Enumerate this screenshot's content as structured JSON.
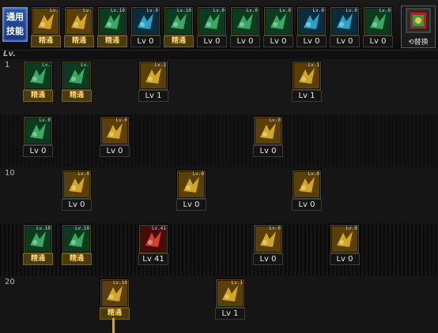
{
  "header": {
    "common_tab": [
      "通用",
      "技能"
    ],
    "lv_label": "Lv.",
    "swap_label": "⟲替换"
  },
  "colors": {
    "gold": "#e0b12c",
    "green": "#3fb56b",
    "blue": "#2fb0d8",
    "red": "#c62a2a"
  },
  "quickbar": [
    {
      "icon": "gold-fist-skill-icon",
      "tag": "Lv.",
      "caption": "精通",
      "kind": "mast",
      "color": "gold"
    },
    {
      "icon": "gold-claw-skill-icon",
      "tag": "Lv.",
      "caption": "精通",
      "kind": "mast",
      "color": "gold"
    },
    {
      "icon": "green-runner-skill-icon",
      "tag": "Lv.10",
      "caption": "精通",
      "kind": "mast",
      "color": "green"
    },
    {
      "icon": "blue-wings-skill-icon",
      "tag": "Lv.0",
      "caption": "Lv 0",
      "kind": "lv",
      "color": "blue"
    },
    {
      "icon": "green-target-skill-icon",
      "tag": "Lv.10",
      "caption": "精通",
      "kind": "mast",
      "color": "green"
    },
    {
      "icon": "green-target-skill-icon",
      "tag": "Lv.0",
      "caption": "Lv 0",
      "kind": "lv",
      "color": "green"
    },
    {
      "icon": "green-figure-skill-icon",
      "tag": "Lv.0",
      "caption": "Lv 0",
      "kind": "lv",
      "color": "green"
    },
    {
      "icon": "green-figure-skill-icon",
      "tag": "Lv.0",
      "caption": "Lv 0",
      "kind": "lv",
      "color": "green"
    },
    {
      "icon": "blue-ring-skill-icon",
      "tag": "Lv.0",
      "caption": "Lv 0",
      "kind": "lv",
      "color": "blue"
    },
    {
      "icon": "blue-robot-skill-icon",
      "tag": "Lv.0",
      "caption": "Lv 0",
      "kind": "lv",
      "color": "blue"
    },
    {
      "icon": "green-kick-skill-icon",
      "tag": "Lv.0",
      "caption": "Lv 0",
      "kind": "lv",
      "color": "green"
    }
  ],
  "tree": {
    "rows": [
      "1",
      "",
      "10",
      "",
      "20"
    ],
    "skills": [
      {
        "row": 0,
        "col": 0,
        "icon": "green-move-skill-icon",
        "tag": "Lv.",
        "caption": "精通",
        "kind": "mast",
        "color": "green"
      },
      {
        "row": 0,
        "col": 1,
        "icon": "green-spark-skill-icon",
        "tag": "Lv.",
        "caption": "精通",
        "kind": "mast",
        "color": "green"
      },
      {
        "row": 0,
        "col": 3,
        "icon": "gold-dash-skill-icon",
        "tag": "Lv.1",
        "caption": "Lv 1",
        "kind": "lv",
        "color": "gold"
      },
      {
        "row": 0,
        "col": 7,
        "icon": "gold-slash-skill-icon",
        "tag": "Lv.1",
        "caption": "Lv 1",
        "kind": "lv",
        "color": "gold"
      },
      {
        "row": 1,
        "col": 0,
        "icon": "green-shield-skill-icon",
        "tag": "Lv.0",
        "caption": "Lv 0",
        "kind": "lv",
        "color": "green"
      },
      {
        "row": 1,
        "col": 2,
        "icon": "gold-bolt-skill-icon",
        "tag": "Lv.0",
        "caption": "Lv 0",
        "kind": "lv",
        "color": "gold"
      },
      {
        "row": 1,
        "col": 6,
        "icon": "gold-gear-skill-icon",
        "tag": "Lv.0",
        "caption": "Lv 0",
        "kind": "lv",
        "color": "gold"
      },
      {
        "row": 2,
        "col": 1,
        "icon": "gold-fistpunch-skill-icon",
        "tag": "Lv.0",
        "caption": "Lv 0",
        "kind": "lv",
        "color": "gold"
      },
      {
        "row": 2,
        "col": 4,
        "icon": "gold-burst-skill-icon",
        "tag": "Lv.0",
        "caption": "Lv 0",
        "kind": "lv",
        "color": "gold"
      },
      {
        "row": 2,
        "col": 7,
        "icon": "gold-arrow-skill-icon",
        "tag": "Lv.0",
        "caption": "Lv 0",
        "kind": "lv",
        "color": "gold"
      },
      {
        "row": 3,
        "col": 0,
        "icon": "green-spiral-skill-icon",
        "tag": "Lv.10",
        "caption": "精通",
        "kind": "mast",
        "color": "green"
      },
      {
        "row": 3,
        "col": 1,
        "icon": "green-clover-skill-icon",
        "tag": "Lv.10",
        "caption": "精通",
        "kind": "mast",
        "color": "green"
      },
      {
        "row": 3,
        "col": 3,
        "icon": "red-blast-skill-icon",
        "tag": "Lv.41",
        "caption": "Lv 41",
        "kind": "lv",
        "color": "red"
      },
      {
        "row": 3,
        "col": 6,
        "icon": "gold-sweep-skill-icon",
        "tag": "Lv.0",
        "caption": "Lv 0",
        "kind": "lv",
        "color": "gold"
      },
      {
        "row": 3,
        "col": 8,
        "icon": "gold-cross-skill-icon",
        "tag": "Lv.0",
        "caption": "Lv 0",
        "kind": "lv",
        "color": "gold"
      },
      {
        "row": 4,
        "col": 2,
        "icon": "gold-aura-skill-icon",
        "tag": "Lv.10",
        "caption": "精通",
        "kind": "mast",
        "color": "gold"
      },
      {
        "row": 4,
        "col": 5,
        "icon": "gold-runkick-skill-icon",
        "tag": "Lv.1",
        "caption": "Lv 1",
        "kind": "lv",
        "color": "gold"
      }
    ]
  }
}
